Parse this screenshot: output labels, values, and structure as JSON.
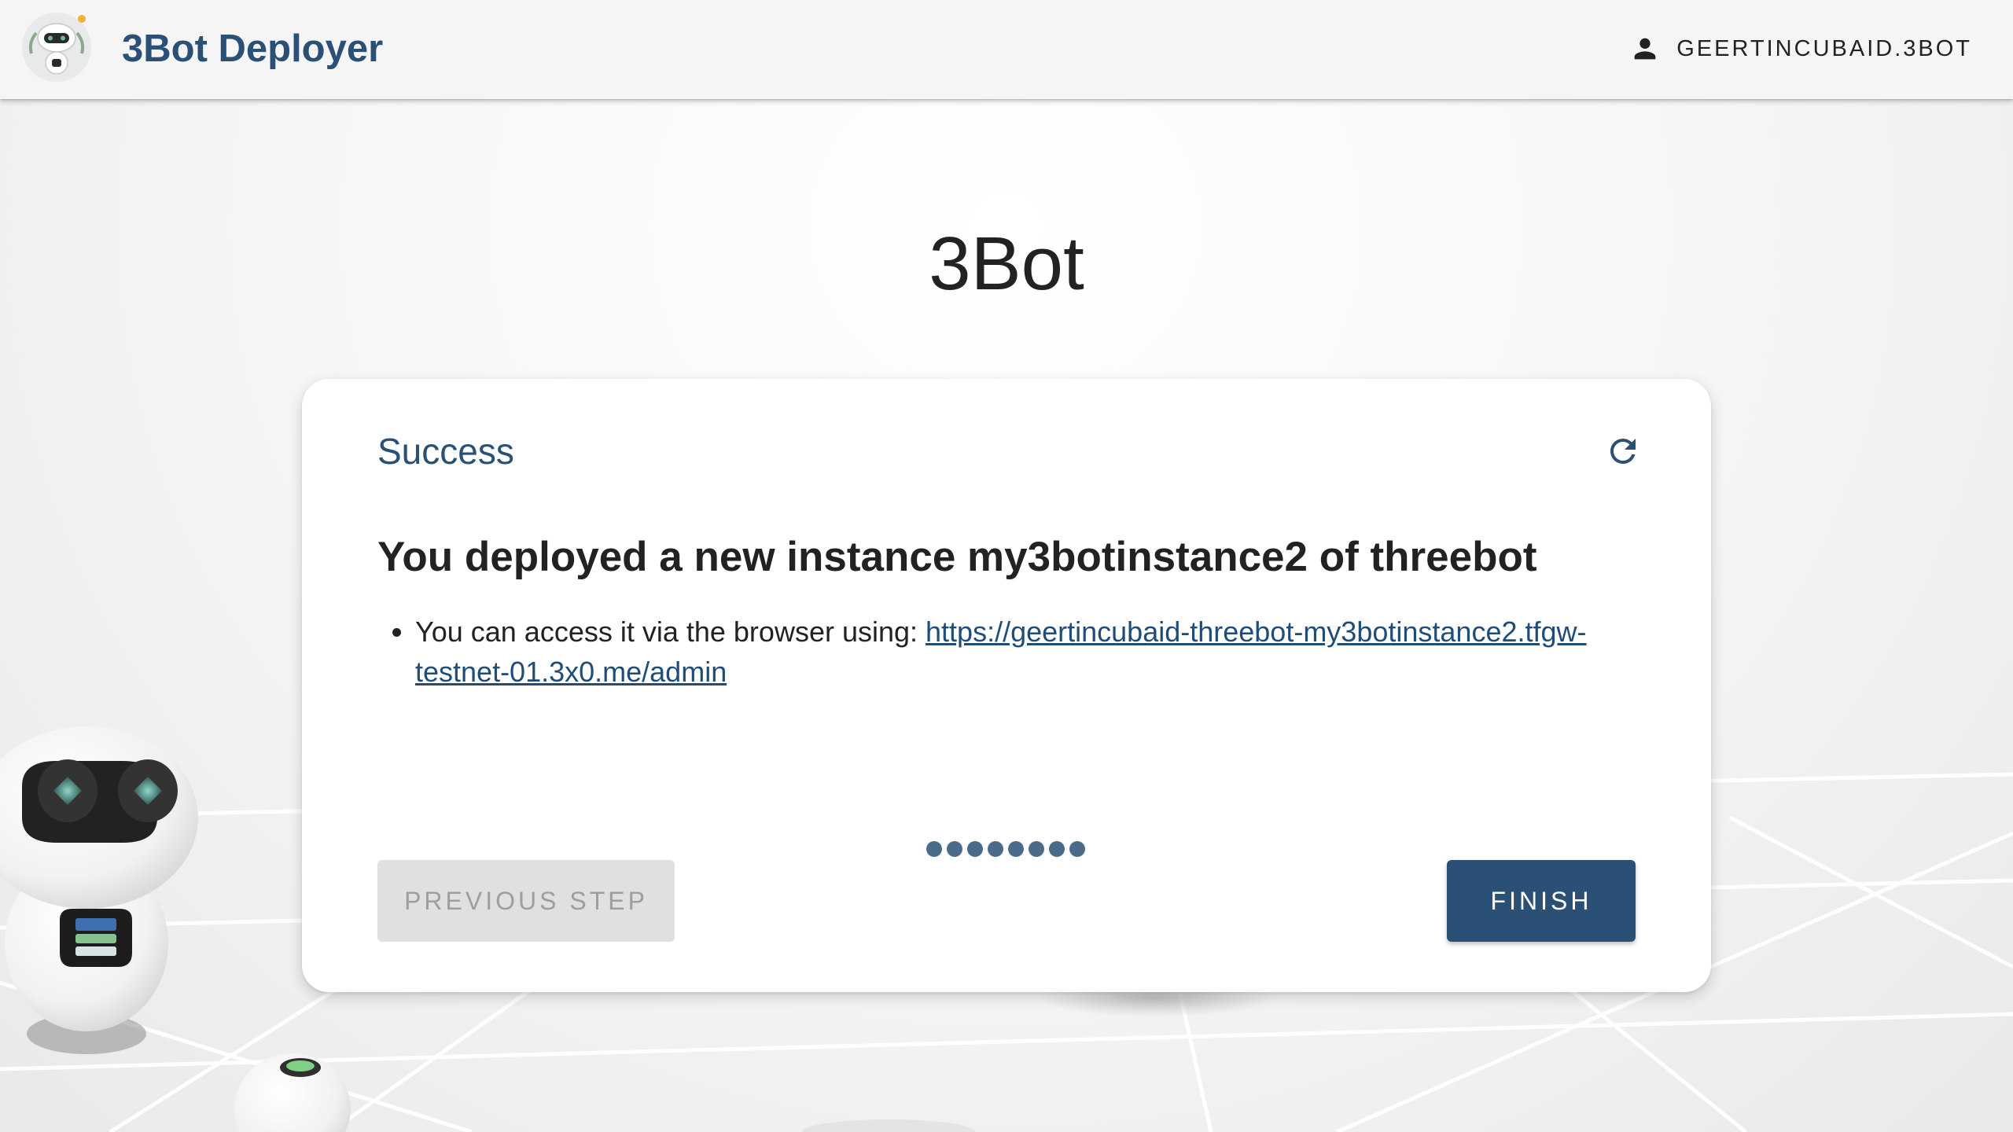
{
  "appbar": {
    "title": "3Bot Deployer",
    "user_label": "GEERTINCUBAID.3BOT",
    "logo_icon": "robot-logo-icon",
    "user_icon": "person-icon"
  },
  "page": {
    "heading": "3Bot"
  },
  "card": {
    "step_title": "Success",
    "refresh_icon": "refresh-icon",
    "result_heading": "You deployed a new instance my3botinstance2 of threebot",
    "bullet_prefix": "You can access it via the browser using: ",
    "access_link": "https://geertincubaid-threebot-my3botinstance2.tfgw-testnet-01.3x0.me/admin",
    "step_count": 8,
    "previous_label": "PREVIOUS STEP",
    "finish_label": "FINISH"
  },
  "colors": {
    "brand": "#2b5075",
    "link": "#1f4d78",
    "step_dot": "#4a6a8a",
    "disabled_bg": "#e0e0e0",
    "disabled_text": "#9e9e9e"
  }
}
